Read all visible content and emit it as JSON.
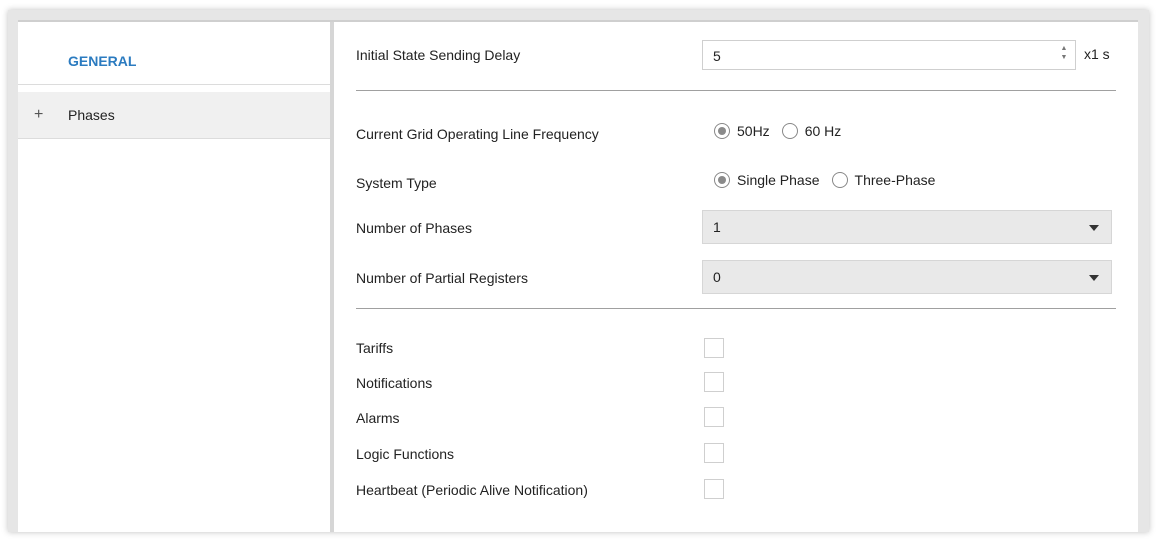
{
  "sidebar": {
    "items": [
      {
        "label": "GENERAL"
      },
      {
        "icon": "plus-icon",
        "label": "Phases"
      }
    ]
  },
  "settings": {
    "initial_delay": {
      "label": "Initial State Sending Delay",
      "value": "5",
      "unit": "x1 s"
    },
    "frequency": {
      "label": "Current Grid Operating Line Frequency",
      "options": [
        "50Hz",
        "60 Hz"
      ],
      "selected": "50Hz"
    },
    "system_type": {
      "label": "System Type",
      "options": [
        "Single Phase",
        "Three-Phase"
      ],
      "selected": "Single Phase"
    },
    "num_phases": {
      "label": "Number of Phases",
      "value": "1"
    },
    "num_partial_registers": {
      "label": "Number of Partial Registers",
      "value": "0"
    }
  },
  "checkboxes": [
    {
      "label": "Tariffs",
      "checked": false
    },
    {
      "label": "Notifications",
      "checked": false
    },
    {
      "label": "Alarms",
      "checked": false
    },
    {
      "label": "Logic Functions",
      "checked": false
    },
    {
      "label": "Heartbeat (Periodic Alive Notification)",
      "checked": false
    }
  ],
  "colors": {
    "accent": "#2b7bc0",
    "select_bg": "#e9e9e9"
  }
}
